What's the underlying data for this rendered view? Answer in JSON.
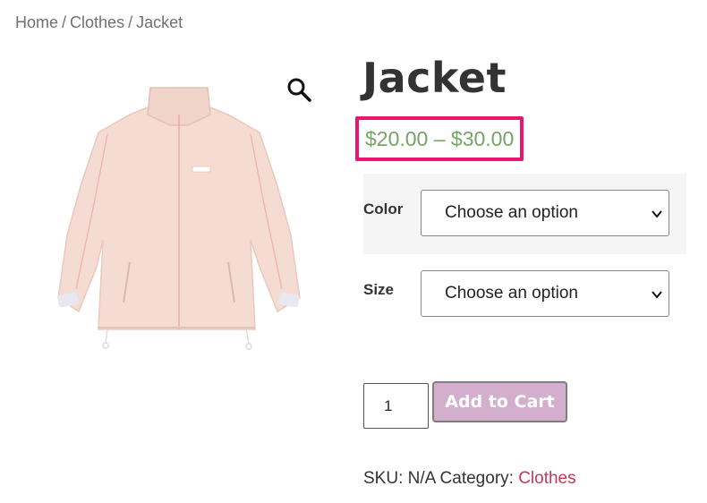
{
  "breadcrumb": {
    "home": "Home",
    "category": "Clothes",
    "current": "Jacket",
    "separator": "/"
  },
  "product": {
    "title": "Jacket",
    "price_range": "$20.00 – $30.00",
    "image_icon": "jacket-image"
  },
  "variations": [
    {
      "label": "Color",
      "selected": "Choose an option"
    },
    {
      "label": "Size",
      "selected": "Choose an option"
    }
  ],
  "cart": {
    "quantity": "1",
    "add_button": "Add to Cart"
  },
  "meta": {
    "sku_label": "SKU:",
    "sku_value": "N/A",
    "category_label": "Category:",
    "category_value": "Clothes"
  },
  "icons": {
    "zoom": "magnifier-icon",
    "dropdown": "chevron-down-icon"
  },
  "colors": {
    "price": "#77a464",
    "highlight_border": "#e8166c",
    "button_bg": "#d3afcd",
    "category_link": "#c0395a"
  }
}
